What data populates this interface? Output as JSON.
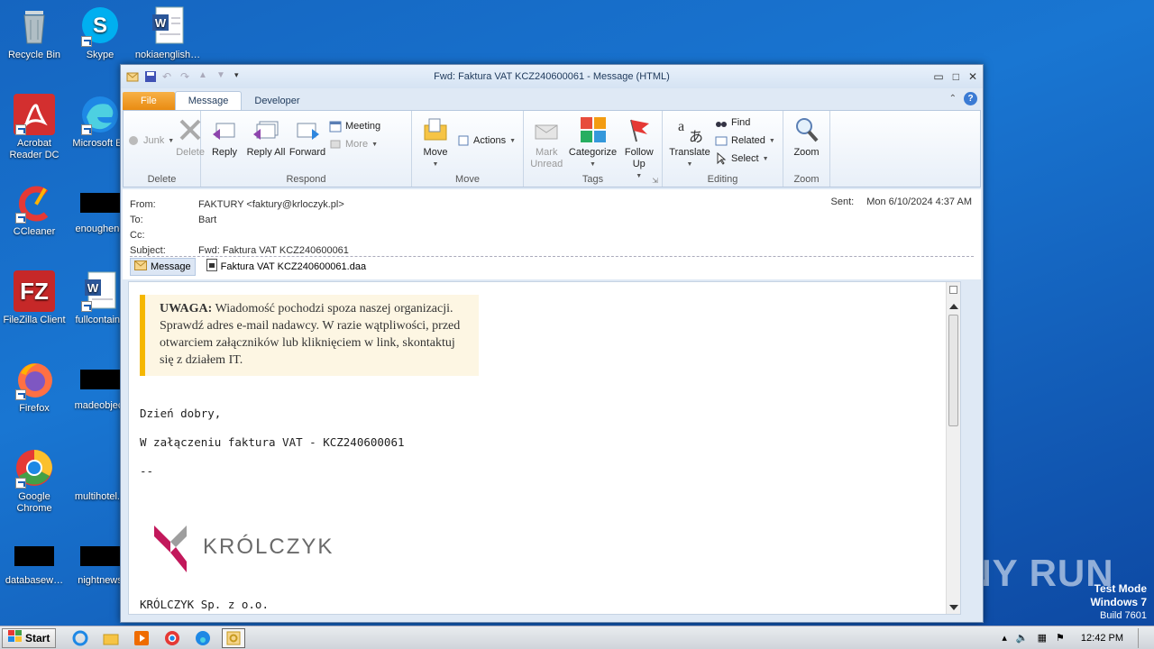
{
  "desktop": {
    "icons": [
      {
        "label": "Recycle Bin"
      },
      {
        "label": "Skype"
      },
      {
        "label": "nokiaenglish…"
      },
      {
        "label": "Acrobat Reader DC"
      },
      {
        "label": "Microsoft Ed"
      },
      {
        "label": "CCleaner"
      },
      {
        "label": "enoughene"
      },
      {
        "label": "FileZilla Client"
      },
      {
        "label": "fullcontains"
      },
      {
        "label": "Firefox"
      },
      {
        "label": "madeobject"
      },
      {
        "label": "Google Chrome"
      },
      {
        "label": "multihotel.p"
      },
      {
        "label": "databasew…"
      },
      {
        "label": "nightnews"
      }
    ]
  },
  "window": {
    "title": "Fwd: Faktura VAT KCZ240600061 - Message (HTML)",
    "tabs": [
      "File",
      "Message",
      "Developer"
    ],
    "ribbon": {
      "delete_group": {
        "label": "Delete",
        "junk": "Junk",
        "delete": "Delete"
      },
      "respond_group": {
        "label": "Respond",
        "reply": "Reply",
        "reply_all": "Reply All",
        "forward": "Forward",
        "meeting": "Meeting",
        "more": "More"
      },
      "move_group": {
        "label": "Move",
        "move": "Move",
        "actions": "Actions"
      },
      "tags_group": {
        "label": "Tags",
        "mark_unread": "Mark Unread",
        "categorize": "Categorize",
        "follow_up": "Follow Up"
      },
      "editing_group": {
        "label": "Editing",
        "translate": "Translate",
        "find": "Find",
        "related": "Related",
        "select": "Select"
      },
      "zoom_group": {
        "label": "Zoom",
        "zoom": "Zoom"
      }
    },
    "header": {
      "from_label": "From:",
      "from_value": "FAKTURY <faktury@krloczyk.pl>",
      "to_label": "To:",
      "to_value": "Bart",
      "cc_label": "Cc:",
      "subject_label": "Subject:",
      "subject_value": "Fwd: Faktura VAT KCZ240600061",
      "sent_label": "Sent:",
      "sent_value": "Mon 6/10/2024 4:37 AM"
    },
    "attachments": {
      "message_tab": "Message",
      "file": "Faktura VAT KCZ240600061.daa"
    },
    "body": {
      "warning_bold": "UWAGA:",
      "warning_text": " Wiadomość pochodzi spoza naszej organizacji. Sprawdź adres e-mail nadawcy. W razie wątpliwości, przed otwarciem załączników lub kliknięciem w link, skontaktuj się z działem IT.",
      "greeting": "Dzień dobry,",
      "line1": "W załączeniu faktura VAT - KCZ240600061",
      "sig_sep": "--",
      "logo_text": "KRÓLCZYK",
      "company": "KRÓLCZYK Sp. z o.o."
    }
  },
  "watermark": {
    "line1": "Test Mode",
    "line2": "Windows 7",
    "line3": "Build 7601",
    "brand": "ANY RUN"
  },
  "taskbar": {
    "start": "Start",
    "clock": "12:42 PM"
  }
}
